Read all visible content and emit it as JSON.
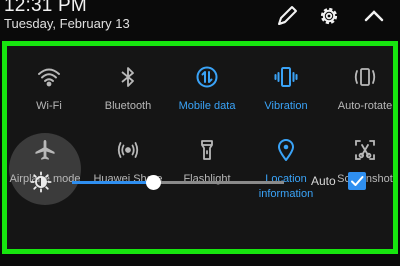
{
  "status": {
    "time": "12:31 PM",
    "date": "Tuesday, February 13"
  },
  "header_icons": [
    "edit-icon",
    "gear-icon",
    "chevron-up-icon"
  ],
  "tiles": [
    {
      "label": "Wi-Fi",
      "icon": "wifi-icon",
      "on": false
    },
    {
      "label": "Bluetooth",
      "icon": "bluetooth-icon",
      "on": false
    },
    {
      "label": "Mobile data",
      "icon": "mobile-data-icon",
      "on": true
    },
    {
      "label": "Vibration",
      "icon": "vibration-icon",
      "on": true
    },
    {
      "label": "Auto-rotate",
      "icon": "auto-rotate-icon",
      "on": false
    },
    {
      "label": "Airplane mode",
      "icon": "airplane-icon",
      "on": false
    },
    {
      "label": "Huawei Share",
      "icon": "huawei-share-icon",
      "on": false
    },
    {
      "label": "Flashlight",
      "icon": "flashlight-icon",
      "on": false
    },
    {
      "label": "Location information",
      "icon": "location-icon",
      "on": true
    },
    {
      "label": "Screenshot",
      "icon": "screenshot-icon",
      "on": false
    }
  ],
  "brightness": {
    "level": 0.38,
    "auto_label": "Auto",
    "auto_checked": true
  },
  "colors": {
    "accent": "#2f8ff0",
    "highlight_border": "#17e60f",
    "off_icon": "#b8b8b8"
  }
}
